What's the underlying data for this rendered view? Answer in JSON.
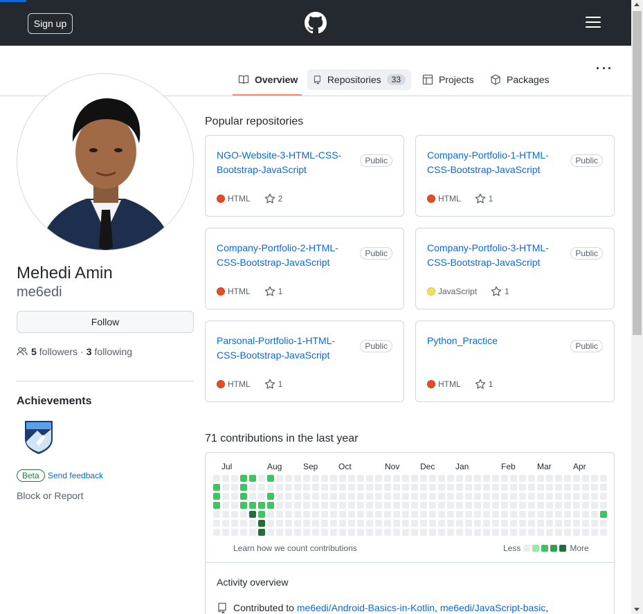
{
  "header": {
    "signup_label": "Sign up"
  },
  "tabs": [
    {
      "label": "Overview"
    },
    {
      "label": "Repositories",
      "count": "33"
    },
    {
      "label": "Projects"
    },
    {
      "label": "Packages"
    }
  ],
  "profile": {
    "full_name": "Mehedi Amin",
    "username": "me6edi",
    "follow_label": "Follow",
    "followers_count": "5",
    "followers_label": "followers",
    "separator": "·",
    "following_count": "3",
    "following_label": "following",
    "achievements_title": "Achievements",
    "beta_label": "Beta",
    "feedback_label": "Send feedback",
    "block_report": "Block or Report"
  },
  "popular": {
    "title": "Popular repositories",
    "repos": [
      {
        "name": "NGO-Website-3-HTML-CSS-Bootstrap-JavaScript",
        "visibility": "Public",
        "language": "HTML",
        "lang_color": "#e34c26",
        "stars": "2"
      },
      {
        "name": "Company-Portfolio-1-HTML-CSS-Bootstrap-JavaScript",
        "visibility": "Public",
        "language": "HTML",
        "lang_color": "#e34c26",
        "stars": "1"
      },
      {
        "name": "Company-Portfolio-2-HTML-CSS-Bootstrap-JavaScript",
        "visibility": "Public",
        "language": "HTML",
        "lang_color": "#e34c26",
        "stars": "1"
      },
      {
        "name": "Company-Portfolio-3-HTML-CSS-Bootstrap-JavaScript",
        "visibility": "Public",
        "language": "JavaScript",
        "lang_color": "#f1e05a",
        "stars": "1"
      },
      {
        "name": "Parsonal-Portfolio-1-HTML-CSS-Bootstrap-JavaScript",
        "visibility": "Public",
        "language": "HTML",
        "lang_color": "#e34c26",
        "stars": "1"
      },
      {
        "name": "Python_Practice",
        "visibility": "Public",
        "language": "HTML",
        "lang_color": "#e34c26",
        "stars": "1"
      }
    ]
  },
  "contributions": {
    "title": "71 contributions in the last year",
    "months": [
      "Jul",
      "Aug",
      "Sep",
      "Oct",
      "Nov",
      "Dec",
      "Jan",
      "Feb",
      "Mar",
      "Apr"
    ],
    "learn_label": "Learn how we count contributions",
    "legend_less": "Less",
    "legend_more": "More",
    "level_colors": [
      "#ebedf0",
      "#9be9a8",
      "#40c463",
      "#30a14e",
      "#216e39"
    ],
    "weeks": [
      [
        0,
        2,
        2,
        2,
        0,
        0,
        0
      ],
      [
        0,
        0,
        0,
        0,
        0,
        0,
        0
      ],
      [
        0,
        0,
        0,
        0,
        0,
        0,
        0
      ],
      [
        2,
        2,
        2,
        2,
        0,
        0,
        0
      ],
      [
        2,
        0,
        0,
        2,
        4,
        0,
        0
      ],
      [
        0,
        0,
        0,
        2,
        2,
        4,
        4
      ],
      [
        2,
        0,
        2,
        2,
        0,
        0,
        0
      ],
      [
        0,
        0,
        0,
        0,
        0,
        0,
        0
      ],
      [
        0,
        0,
        0,
        0,
        0,
        0,
        0
      ],
      [
        0,
        0,
        0,
        0,
        0,
        0,
        0
      ],
      [
        0,
        0,
        0,
        0,
        0,
        0,
        0
      ],
      [
        0,
        0,
        0,
        0,
        0,
        0,
        0
      ],
      [
        0,
        0,
        0,
        0,
        0,
        0,
        0
      ],
      [
        0,
        0,
        0,
        0,
        0,
        0,
        0
      ],
      [
        0,
        0,
        0,
        0,
        0,
        0,
        0
      ],
      [
        0,
        0,
        0,
        0,
        0,
        0,
        0
      ],
      [
        0,
        0,
        0,
        0,
        0,
        0,
        0
      ],
      [
        0,
        0,
        0,
        0,
        0,
        0,
        0
      ],
      [
        0,
        0,
        0,
        0,
        0,
        0,
        0
      ],
      [
        0,
        0,
        0,
        0,
        0,
        0,
        0
      ],
      [
        0,
        0,
        0,
        0,
        0,
        0,
        0
      ],
      [
        0,
        0,
        0,
        0,
        0,
        0,
        0
      ],
      [
        0,
        0,
        0,
        0,
        0,
        0,
        0
      ],
      [
        0,
        0,
        0,
        0,
        0,
        0,
        0
      ],
      [
        0,
        0,
        0,
        0,
        0,
        0,
        0
      ],
      [
        0,
        0,
        0,
        0,
        0,
        0,
        0
      ],
      [
        0,
        0,
        0,
        0,
        0,
        0,
        0
      ],
      [
        0,
        0,
        0,
        0,
        0,
        0,
        0
      ],
      [
        0,
        0,
        0,
        0,
        0,
        0,
        0
      ],
      [
        0,
        0,
        0,
        0,
        0,
        0,
        0
      ],
      [
        0,
        0,
        0,
        0,
        0,
        0,
        0
      ],
      [
        0,
        0,
        0,
        0,
        0,
        0,
        0
      ],
      [
        0,
        0,
        0,
        0,
        0,
        0,
        0
      ],
      [
        0,
        0,
        0,
        0,
        0,
        0,
        0
      ],
      [
        0,
        0,
        0,
        0,
        0,
        0,
        0
      ],
      [
        0,
        0,
        0,
        0,
        0,
        0,
        0
      ],
      [
        0,
        0,
        0,
        0,
        0,
        0,
        0
      ],
      [
        0,
        0,
        0,
        0,
        0,
        0,
        0
      ],
      [
        0,
        0,
        0,
        0,
        0,
        0,
        0
      ],
      [
        0,
        0,
        0,
        0,
        0,
        0,
        0
      ],
      [
        0,
        0,
        0,
        0,
        0,
        0,
        0
      ],
      [
        0,
        0,
        0,
        0,
        0,
        0,
        0
      ],
      [
        0,
        0,
        0,
        0,
        0,
        0,
        0
      ],
      [
        0,
        0,
        0,
        0,
        2,
        0,
        0
      ]
    ]
  },
  "activity": {
    "title": "Activity overview",
    "contributed_prefix": "Contributed to",
    "repo_link_1": "me6edi/Android-Basics-in-Kotlin",
    "link_sep": ",",
    "repo_link_2": "me6edi/JavaScript-basic",
    "link_end": ","
  }
}
